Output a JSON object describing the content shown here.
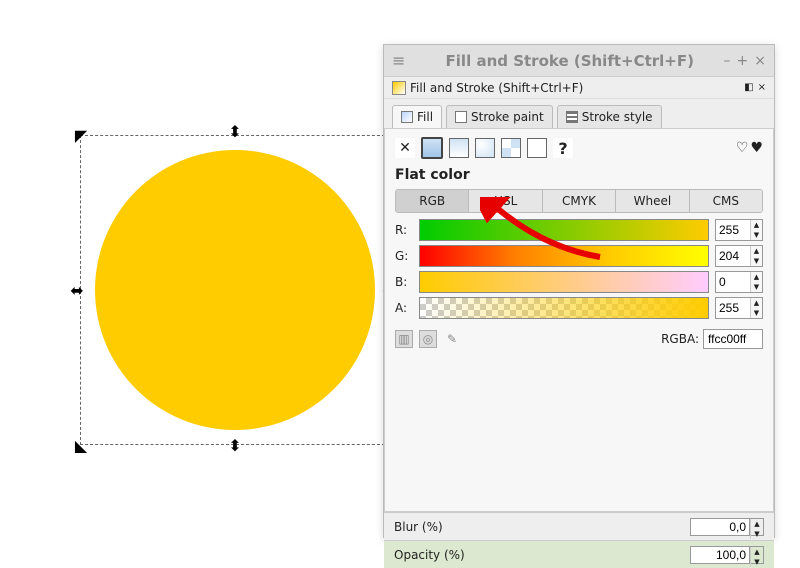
{
  "titlebar": {
    "title": "Fill and Stroke (Shift+Ctrl+F)"
  },
  "subheader": {
    "title": "Fill and Stroke (Shift+Ctrl+F)"
  },
  "tabs": {
    "fill": "Fill",
    "stroke_paint": "Stroke paint",
    "stroke_style": "Stroke style"
  },
  "flat_color_label": "Flat color",
  "modes": {
    "rgb": "RGB",
    "hsl": "HSL",
    "cmyk": "CMYK",
    "wheel": "Wheel",
    "cms": "CMS"
  },
  "sliders": {
    "r": {
      "label": "R:",
      "value": "255"
    },
    "g": {
      "label": "G:",
      "value": "204"
    },
    "b": {
      "label": "B:",
      "value": "0"
    },
    "a": {
      "label": "A:",
      "value": "255"
    }
  },
  "rgba": {
    "label": "RGBA:",
    "value": "ffcc00ff"
  },
  "blur": {
    "label": "Blur (%)",
    "value": "0,0"
  },
  "opacity": {
    "label": "Opacity (%)",
    "value": "100,0"
  },
  "circle_color": "#ffcc00"
}
